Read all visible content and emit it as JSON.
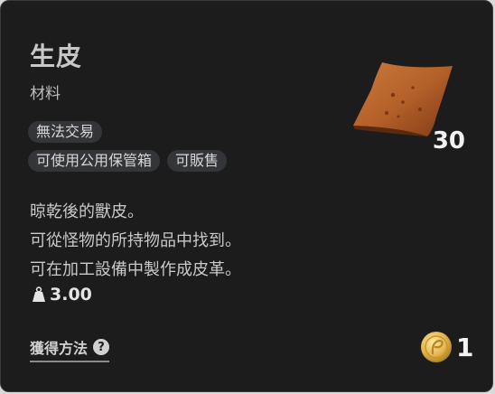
{
  "item": {
    "name": "生皮",
    "category": "材料",
    "tags": [
      [
        "無法交易"
      ],
      [
        "可使用公用保管箱",
        "可販售"
      ]
    ],
    "quantity": "30",
    "description": [
      "晾乾後的獸皮。",
      "可從怪物的所持物品中找到。",
      "可在加工設備中製作成皮革。"
    ],
    "weight": "3.00",
    "how_to_obtain": "獲得方法",
    "help_glyph": "?",
    "coin_count": "1"
  },
  "icons": {
    "item_image": "raw-hide-icon",
    "weight": "weight-icon",
    "help": "help-icon",
    "coin": "gold-coin-icon"
  }
}
